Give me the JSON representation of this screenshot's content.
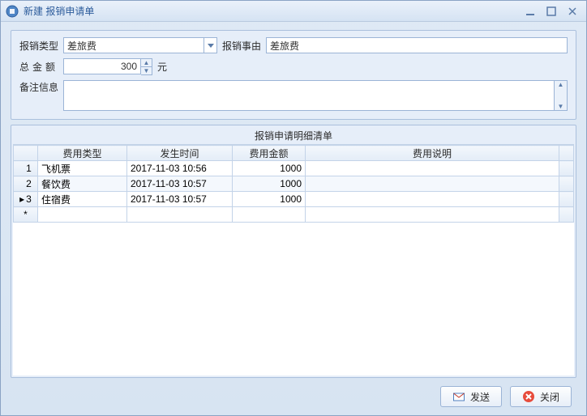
{
  "window": {
    "title": "新建 报销申请单"
  },
  "form": {
    "type_label": "报销类型",
    "type_value": "差旅费",
    "reason_label": "报销事由",
    "reason_value": "差旅费",
    "total_label": "总金额",
    "total_value": "300",
    "total_unit": "元",
    "remark_label": "备注信息",
    "remark_value": ""
  },
  "grid": {
    "title": "报销申请明细清单",
    "columns": {
      "type": "费用类型",
      "time": "发生时间",
      "amount": "费用金额",
      "desc": "费用说明"
    },
    "rows": [
      {
        "idx": "1",
        "mark": "",
        "type": "飞机票",
        "time": "2017-11-03 10:56",
        "amount": "1000",
        "desc": ""
      },
      {
        "idx": "2",
        "mark": "",
        "type": "餐饮费",
        "time": "2017-11-03 10:57",
        "amount": "1000",
        "desc": ""
      },
      {
        "idx": "3",
        "mark": "▸",
        "type": "住宿费",
        "time": "2017-11-03 10:57",
        "amount": "1000",
        "desc": ""
      }
    ],
    "new_row_mark": "*"
  },
  "buttons": {
    "send": "发送",
    "close": "关闭"
  }
}
